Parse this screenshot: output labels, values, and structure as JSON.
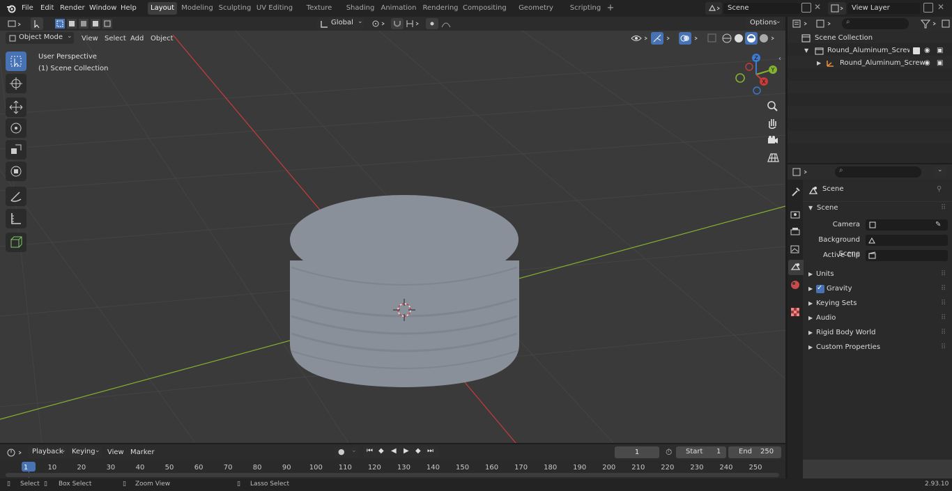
{
  "topbar": {
    "menus": [
      "File",
      "Edit",
      "Render",
      "Window",
      "Help"
    ],
    "workspaces": [
      "Layout",
      "Modeling",
      "Sculpting",
      "UV Editing",
      "Texture Paint",
      "Shading",
      "Animation",
      "Rendering",
      "Compositing",
      "Geometry Nodes",
      "Scripting"
    ],
    "active_workspace": "Layout",
    "add_tab": "+",
    "scene": "Scene",
    "view_layer": "View Layer"
  },
  "toolheader": {
    "transform_orientation": "Global",
    "options": "Options"
  },
  "header3d": {
    "mode": "Object Mode",
    "menus": [
      "View",
      "Select",
      "Add",
      "Object"
    ]
  },
  "viewport": {
    "title": "User Perspective",
    "subtitle": "(1) Scene Collection",
    "gizmo": {
      "x": "X",
      "y": "Y",
      "z": "Z"
    }
  },
  "outliner": {
    "root": "Scene Collection",
    "items": [
      {
        "label": "Round_Aluminum_Screw_Cap"
      },
      {
        "label": "Round_Aluminum_Screw"
      }
    ]
  },
  "properties": {
    "title": "Scene",
    "section": "Scene",
    "fields": [
      {
        "label": "Camera"
      },
      {
        "label": "Background Scene"
      },
      {
        "label": "Active Clip"
      }
    ],
    "panels": [
      "Units",
      "Gravity",
      "Keying Sets",
      "Audio",
      "Rigid Body World",
      "Custom Properties"
    ],
    "gravity_checked": true
  },
  "timeline": {
    "menus": [
      "Playback",
      "Keying",
      "View",
      "Marker"
    ],
    "current_frame": "1",
    "start_label": "Start",
    "start": "1",
    "end_label": "End",
    "end": "250",
    "ruler": [
      "1",
      "10",
      "20",
      "30",
      "40",
      "50",
      "60",
      "70",
      "80",
      "90",
      "100",
      "110",
      "120",
      "130",
      "140",
      "150",
      "160",
      "170",
      "180",
      "190",
      "200",
      "210",
      "220",
      "230",
      "240",
      "250"
    ]
  },
  "statusbar": {
    "select": "Select",
    "box_select": "Box Select",
    "zoom_view": "Zoom View",
    "lasso_select": "Lasso Select",
    "version": "2.93.10"
  },
  "colors": {
    "accent": "#4772b3",
    "x_axis": "#c83c3c",
    "y_axis": "#84b12f",
    "object": "#8a909a"
  }
}
